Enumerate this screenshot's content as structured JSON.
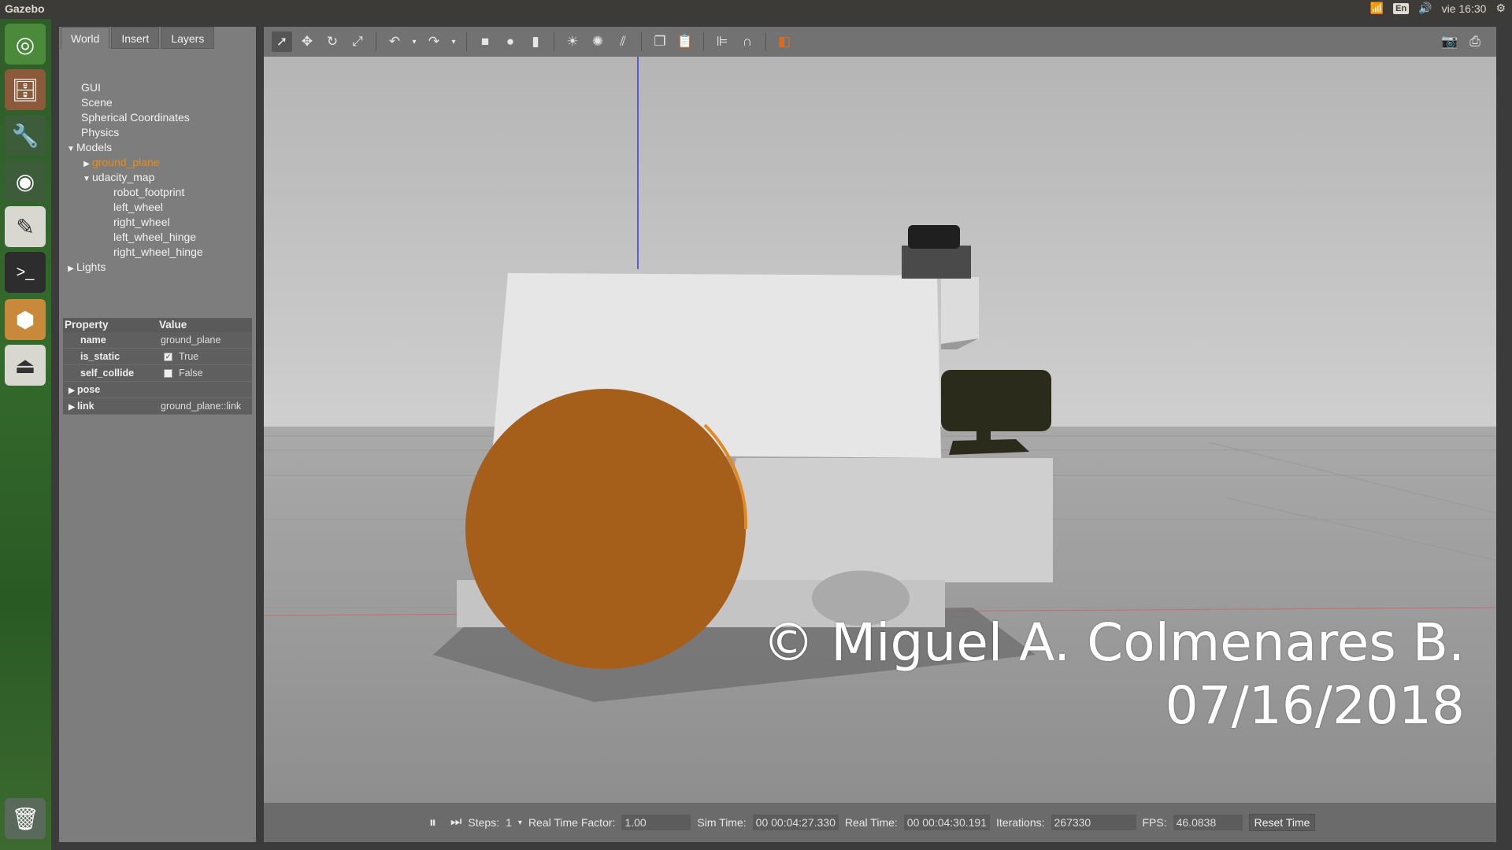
{
  "app_title": "Gazebo",
  "topbar": {
    "keyboard": "En",
    "datetime": "vie 16:30"
  },
  "tabs": [
    "World",
    "Insert",
    "Layers"
  ],
  "tree": {
    "gui": "GUI",
    "scene": "Scene",
    "spherical": "Spherical Coordinates",
    "physics": "Physics",
    "models": "Models",
    "ground_plane": "ground_plane",
    "udacity_map": "udacity_map",
    "robot_footprint": "robot_footprint",
    "left_wheel": "left_wheel",
    "right_wheel": "right_wheel",
    "left_wheel_hinge": "left_wheel_hinge",
    "right_wheel_hinge": "right_wheel_hinge",
    "lights": "Lights"
  },
  "props": {
    "header_property": "Property",
    "header_value": "Value",
    "name_k": "name",
    "name_v": "ground_plane",
    "static_k": "is_static",
    "static_v": "True",
    "collide_k": "self_collide",
    "collide_v": "False",
    "pose_k": "pose",
    "link_k": "link",
    "link_v": "ground_plane::link"
  },
  "status": {
    "steps_label": "Steps:",
    "steps_value": "1",
    "rtf_label": "Real Time Factor:",
    "rtf_value": "1.00",
    "sim_label": "Sim Time:",
    "sim_value": "00 00:04:27.330",
    "real_label": "Real Time:",
    "real_value": "00 00:04:30.191",
    "iter_label": "Iterations:",
    "iter_value": "267330",
    "fps_label": "FPS:",
    "fps_value": "46.0838",
    "reset_label": "Reset Time"
  },
  "watermark": {
    "line1": "© Miguel A. Colmenares B.",
    "line2": "07/16/2018"
  },
  "colors": {
    "selected_model": "#e88d1a",
    "wheel": "#a65f1a",
    "chassis": "#e6e6e6"
  }
}
